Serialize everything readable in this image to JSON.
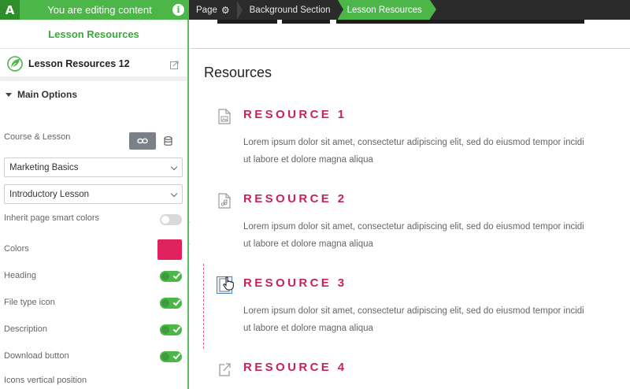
{
  "topbar": {
    "brand_letter": "A",
    "editing_text": "You are editing content",
    "info_icon": "i",
    "breadcrumbs": [
      {
        "label": "Page",
        "icon": "gear-icon"
      },
      {
        "label": "Background Section"
      },
      {
        "label": "Lesson Resources"
      }
    ]
  },
  "sidebar": {
    "title": "Lesson Resources",
    "element_name": "Lesson Resources 12",
    "section_label": "Main Options",
    "course_lesson_label": "Course & Lesson",
    "course_select": "Marketing Basics",
    "lesson_select": "Introductory Lesson",
    "options": {
      "inherit_colors": {
        "label": "Inherit page smart colors",
        "on": false
      },
      "colors": {
        "label": "Colors",
        "value": "#e0235f"
      },
      "heading": {
        "label": "Heading",
        "on": true
      },
      "file_type_icon": {
        "label": "File type icon",
        "on": true
      },
      "description": {
        "label": "Description",
        "on": true
      },
      "download_button": {
        "label": "Download button",
        "on": true
      },
      "icons_vertical_position": {
        "label": "Icons vertical position"
      }
    }
  },
  "content": {
    "heading": "Resources",
    "accent_color": "#c8225a",
    "resources": [
      {
        "title": "RESOURCE 1",
        "icon": "file-image-icon",
        "line1": "Lorem ipsum dolor sit amet, consectetur adipiscing elit, sed do eiusmod tempor incidi",
        "line2": "ut labore et dolore magna aliqua"
      },
      {
        "title": "RESOURCE 2",
        "icon": "file-audio-icon",
        "line1": "Lorem ipsum dolor sit amet, consectetur adipiscing elit, sed do eiusmod tempor incidi",
        "line2": "ut labore et dolore magna aliqua"
      },
      {
        "title": "RESOURCE 3",
        "icon": "file-document-icon",
        "line1": "Lorem ipsum dolor sit amet, consectetur adipiscing elit, sed do eiusmod tempor incidi",
        "line2": "ut labore et dolore magna aliqua"
      },
      {
        "title": "RESOURCE 4",
        "icon": "external-link-icon",
        "line1": "",
        "line2": ""
      }
    ]
  }
}
